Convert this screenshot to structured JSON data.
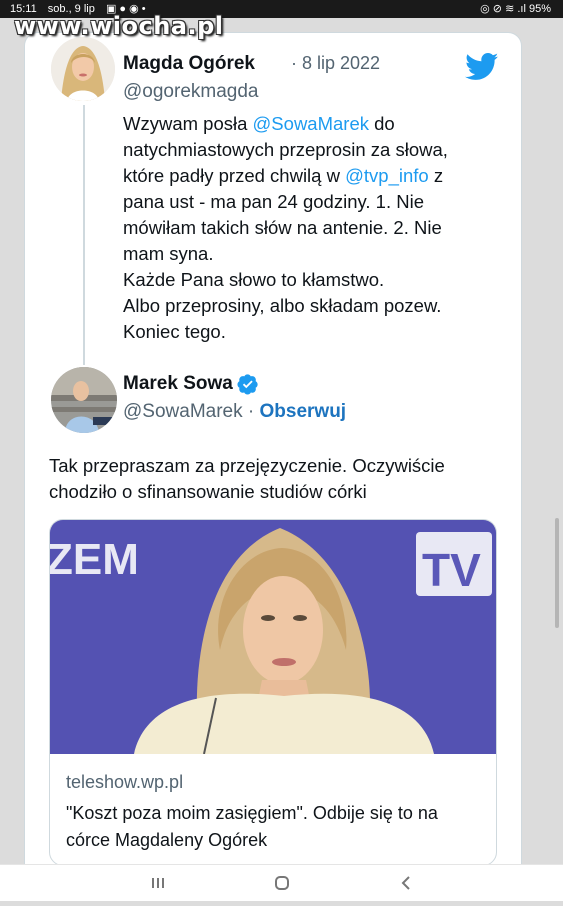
{
  "status_bar": {
    "time": "15:11",
    "date": "sob., 9 lip",
    "battery": "95%"
  },
  "watermark": "www.wiocha.pl",
  "tweet1": {
    "author_name": "Magda Ogórek",
    "date": "· 8 lip 2022",
    "handle": "@ogorekmagda",
    "lines": [
      {
        "pre": "Wzywam posła ",
        "mention": "@SowaMarek",
        "post": " do"
      },
      {
        "pre": "natychmiastowych przeprosin za słowa,",
        "mention": "",
        "post": ""
      },
      {
        "pre": "które padły przed chwilą w ",
        "mention": "@tvp_info",
        "post": " z"
      },
      {
        "pre": "pana ust - ma pan 24 godziny. 1. Nie",
        "mention": "",
        "post": ""
      },
      {
        "pre": "mówiłam takich słów na antenie. 2. Nie",
        "mention": "",
        "post": ""
      },
      {
        "pre": "mam syna.",
        "mention": "",
        "post": ""
      },
      {
        "pre": "Każde Pana słowo to kłamstwo.",
        "mention": "",
        "post": ""
      },
      {
        "pre": "Albo przeprosiny, albo składam pozew.",
        "mention": "",
        "post": ""
      },
      {
        "pre": "Koniec tego.",
        "mention": "",
        "post": ""
      }
    ]
  },
  "tweet2": {
    "author_name": "Marek Sowa",
    "handle": "@SowaMarek",
    "separator": " · ",
    "follow_label": "Obserwuj",
    "text_line1": "Tak przepraszam za przejęzyczenie. Oczywiście",
    "text_line2": "chodziło o sfinansowanie studiów córki"
  },
  "link_card": {
    "image_text_left": "ZEM",
    "image_text_right": "TV",
    "domain": "teleshow.wp.pl",
    "title_line1": "\"Koszt poza moim zasięgiem\". Odbije się to na",
    "title_line2": "córce Magdaleny Ogórek"
  },
  "colors": {
    "mention": "#1d9bf0",
    "twitter_blue": "#1d9bf0",
    "follow": "#1d74bf",
    "image_bg": "#5a58b8"
  },
  "icons": [
    "twitter-logo-icon",
    "verified-badge-icon",
    "recent-apps-icon",
    "home-icon",
    "back-icon"
  ]
}
